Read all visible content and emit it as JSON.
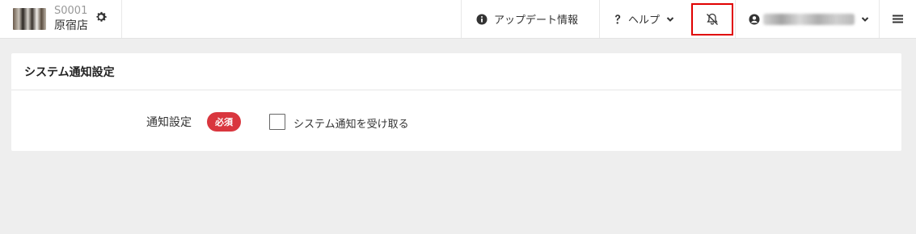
{
  "store": {
    "code": "S0001",
    "name": "原宿店",
    "thumb_icon": "store-thumbnail-image",
    "settings_icon": "gear-icon"
  },
  "nav": {
    "update_label": "アップデート情報",
    "update_icon": "info-circle-icon",
    "help_label": "ヘルプ",
    "help_icon": "question-icon",
    "notifications_icon": "bell-slash-icon",
    "user_icon": "user-circle-icon",
    "menu_icon": "hamburger-icon"
  },
  "colors": {
    "required_badge": "#d9363e",
    "highlight_border": "#e00000",
    "page_background": "#eeeeee"
  },
  "panel": {
    "title": "システム通知設定",
    "field_label": "通知設定",
    "required_label": "必須",
    "checkbox_label": "システム通知を受け取る",
    "checkbox_checked": false
  }
}
